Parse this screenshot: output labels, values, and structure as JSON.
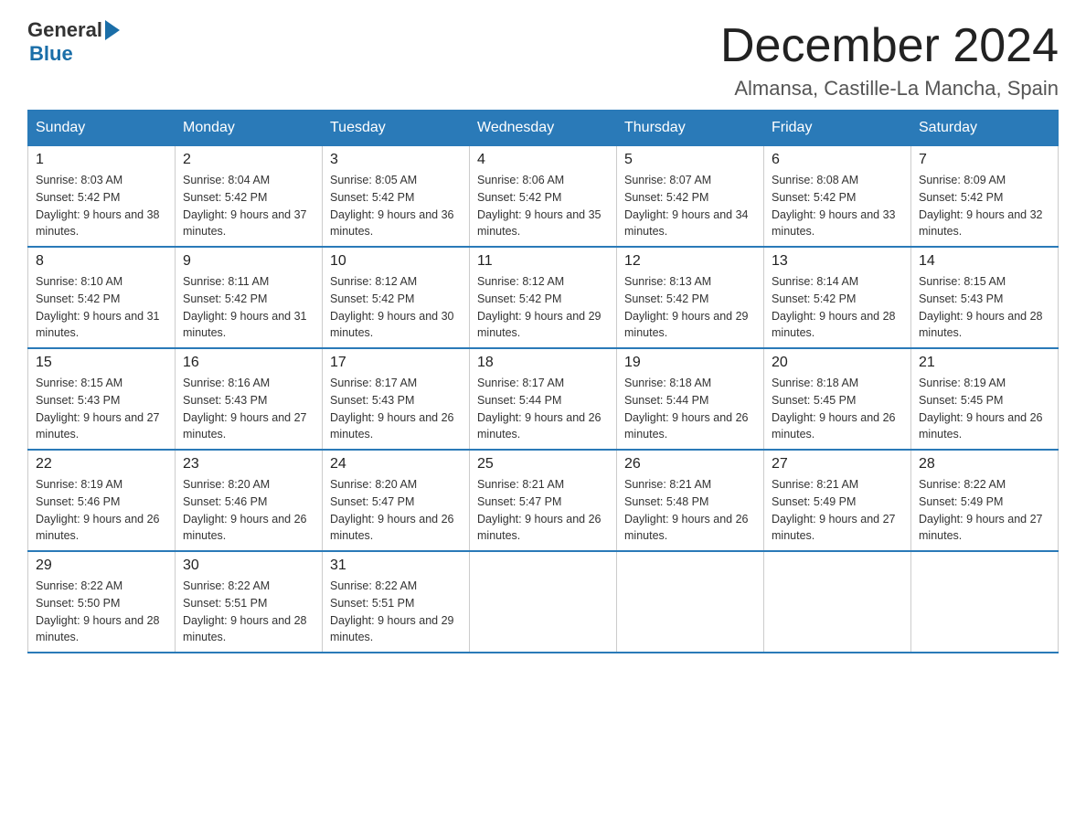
{
  "header": {
    "logo_general": "General",
    "logo_blue": "Blue",
    "main_title": "December 2024",
    "subtitle": "Almansa, Castille-La Mancha, Spain"
  },
  "calendar": {
    "days_of_week": [
      "Sunday",
      "Monday",
      "Tuesday",
      "Wednesday",
      "Thursday",
      "Friday",
      "Saturday"
    ],
    "weeks": [
      [
        {
          "day": "1",
          "sunrise": "8:03 AM",
          "sunset": "5:42 PM",
          "daylight": "9 hours and 38 minutes."
        },
        {
          "day": "2",
          "sunrise": "8:04 AM",
          "sunset": "5:42 PM",
          "daylight": "9 hours and 37 minutes."
        },
        {
          "day": "3",
          "sunrise": "8:05 AM",
          "sunset": "5:42 PM",
          "daylight": "9 hours and 36 minutes."
        },
        {
          "day": "4",
          "sunrise": "8:06 AM",
          "sunset": "5:42 PM",
          "daylight": "9 hours and 35 minutes."
        },
        {
          "day": "5",
          "sunrise": "8:07 AM",
          "sunset": "5:42 PM",
          "daylight": "9 hours and 34 minutes."
        },
        {
          "day": "6",
          "sunrise": "8:08 AM",
          "sunset": "5:42 PM",
          "daylight": "9 hours and 33 minutes."
        },
        {
          "day": "7",
          "sunrise": "8:09 AM",
          "sunset": "5:42 PM",
          "daylight": "9 hours and 32 minutes."
        }
      ],
      [
        {
          "day": "8",
          "sunrise": "8:10 AM",
          "sunset": "5:42 PM",
          "daylight": "9 hours and 31 minutes."
        },
        {
          "day": "9",
          "sunrise": "8:11 AM",
          "sunset": "5:42 PM",
          "daylight": "9 hours and 31 minutes."
        },
        {
          "day": "10",
          "sunrise": "8:12 AM",
          "sunset": "5:42 PM",
          "daylight": "9 hours and 30 minutes."
        },
        {
          "day": "11",
          "sunrise": "8:12 AM",
          "sunset": "5:42 PM",
          "daylight": "9 hours and 29 minutes."
        },
        {
          "day": "12",
          "sunrise": "8:13 AM",
          "sunset": "5:42 PM",
          "daylight": "9 hours and 29 minutes."
        },
        {
          "day": "13",
          "sunrise": "8:14 AM",
          "sunset": "5:42 PM",
          "daylight": "9 hours and 28 minutes."
        },
        {
          "day": "14",
          "sunrise": "8:15 AM",
          "sunset": "5:43 PM",
          "daylight": "9 hours and 28 minutes."
        }
      ],
      [
        {
          "day": "15",
          "sunrise": "8:15 AM",
          "sunset": "5:43 PM",
          "daylight": "9 hours and 27 minutes."
        },
        {
          "day": "16",
          "sunrise": "8:16 AM",
          "sunset": "5:43 PM",
          "daylight": "9 hours and 27 minutes."
        },
        {
          "day": "17",
          "sunrise": "8:17 AM",
          "sunset": "5:43 PM",
          "daylight": "9 hours and 26 minutes."
        },
        {
          "day": "18",
          "sunrise": "8:17 AM",
          "sunset": "5:44 PM",
          "daylight": "9 hours and 26 minutes."
        },
        {
          "day": "19",
          "sunrise": "8:18 AM",
          "sunset": "5:44 PM",
          "daylight": "9 hours and 26 minutes."
        },
        {
          "day": "20",
          "sunrise": "8:18 AM",
          "sunset": "5:45 PM",
          "daylight": "9 hours and 26 minutes."
        },
        {
          "day": "21",
          "sunrise": "8:19 AM",
          "sunset": "5:45 PM",
          "daylight": "9 hours and 26 minutes."
        }
      ],
      [
        {
          "day": "22",
          "sunrise": "8:19 AM",
          "sunset": "5:46 PM",
          "daylight": "9 hours and 26 minutes."
        },
        {
          "day": "23",
          "sunrise": "8:20 AM",
          "sunset": "5:46 PM",
          "daylight": "9 hours and 26 minutes."
        },
        {
          "day": "24",
          "sunrise": "8:20 AM",
          "sunset": "5:47 PM",
          "daylight": "9 hours and 26 minutes."
        },
        {
          "day": "25",
          "sunrise": "8:21 AM",
          "sunset": "5:47 PM",
          "daylight": "9 hours and 26 minutes."
        },
        {
          "day": "26",
          "sunrise": "8:21 AM",
          "sunset": "5:48 PM",
          "daylight": "9 hours and 26 minutes."
        },
        {
          "day": "27",
          "sunrise": "8:21 AM",
          "sunset": "5:49 PM",
          "daylight": "9 hours and 27 minutes."
        },
        {
          "day": "28",
          "sunrise": "8:22 AM",
          "sunset": "5:49 PM",
          "daylight": "9 hours and 27 minutes."
        }
      ],
      [
        {
          "day": "29",
          "sunrise": "8:22 AM",
          "sunset": "5:50 PM",
          "daylight": "9 hours and 28 minutes."
        },
        {
          "day": "30",
          "sunrise": "8:22 AM",
          "sunset": "5:51 PM",
          "daylight": "9 hours and 28 minutes."
        },
        {
          "day": "31",
          "sunrise": "8:22 AM",
          "sunset": "5:51 PM",
          "daylight": "9 hours and 29 minutes."
        },
        null,
        null,
        null,
        null
      ]
    ]
  }
}
